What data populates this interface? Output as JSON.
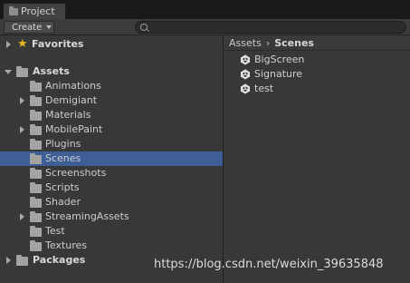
{
  "window": {
    "tab_title": "Project"
  },
  "toolbar": {
    "create_label": "Create",
    "search_value": ""
  },
  "tree": {
    "favorites": "Favorites",
    "assets": "Assets",
    "packages": "Packages",
    "children": [
      {
        "label": "Animations",
        "expandable": false
      },
      {
        "label": "Demigiant",
        "expandable": true
      },
      {
        "label": "Materials",
        "expandable": false
      },
      {
        "label": "MobilePaint",
        "expandable": true
      },
      {
        "label": "Plugins",
        "expandable": false
      },
      {
        "label": "Scenes",
        "expandable": false,
        "selected": true
      },
      {
        "label": "Screenshots",
        "expandable": false
      },
      {
        "label": "Scripts",
        "expandable": false
      },
      {
        "label": "Shader",
        "expandable": false
      },
      {
        "label": "StreamingAssets",
        "expandable": true
      },
      {
        "label": "Test",
        "expandable": false
      },
      {
        "label": "Textures",
        "expandable": false
      }
    ]
  },
  "breadcrumb": {
    "root": "Assets",
    "separator": "›",
    "current": "Scenes"
  },
  "scenes": [
    "BigScreen",
    "Signature",
    "test"
  ],
  "watermark": "https://blog.csdn.net/weixin_39635848",
  "colors": {
    "selection": "#3e5f96",
    "background": "#383838",
    "star": "#e8b422"
  }
}
